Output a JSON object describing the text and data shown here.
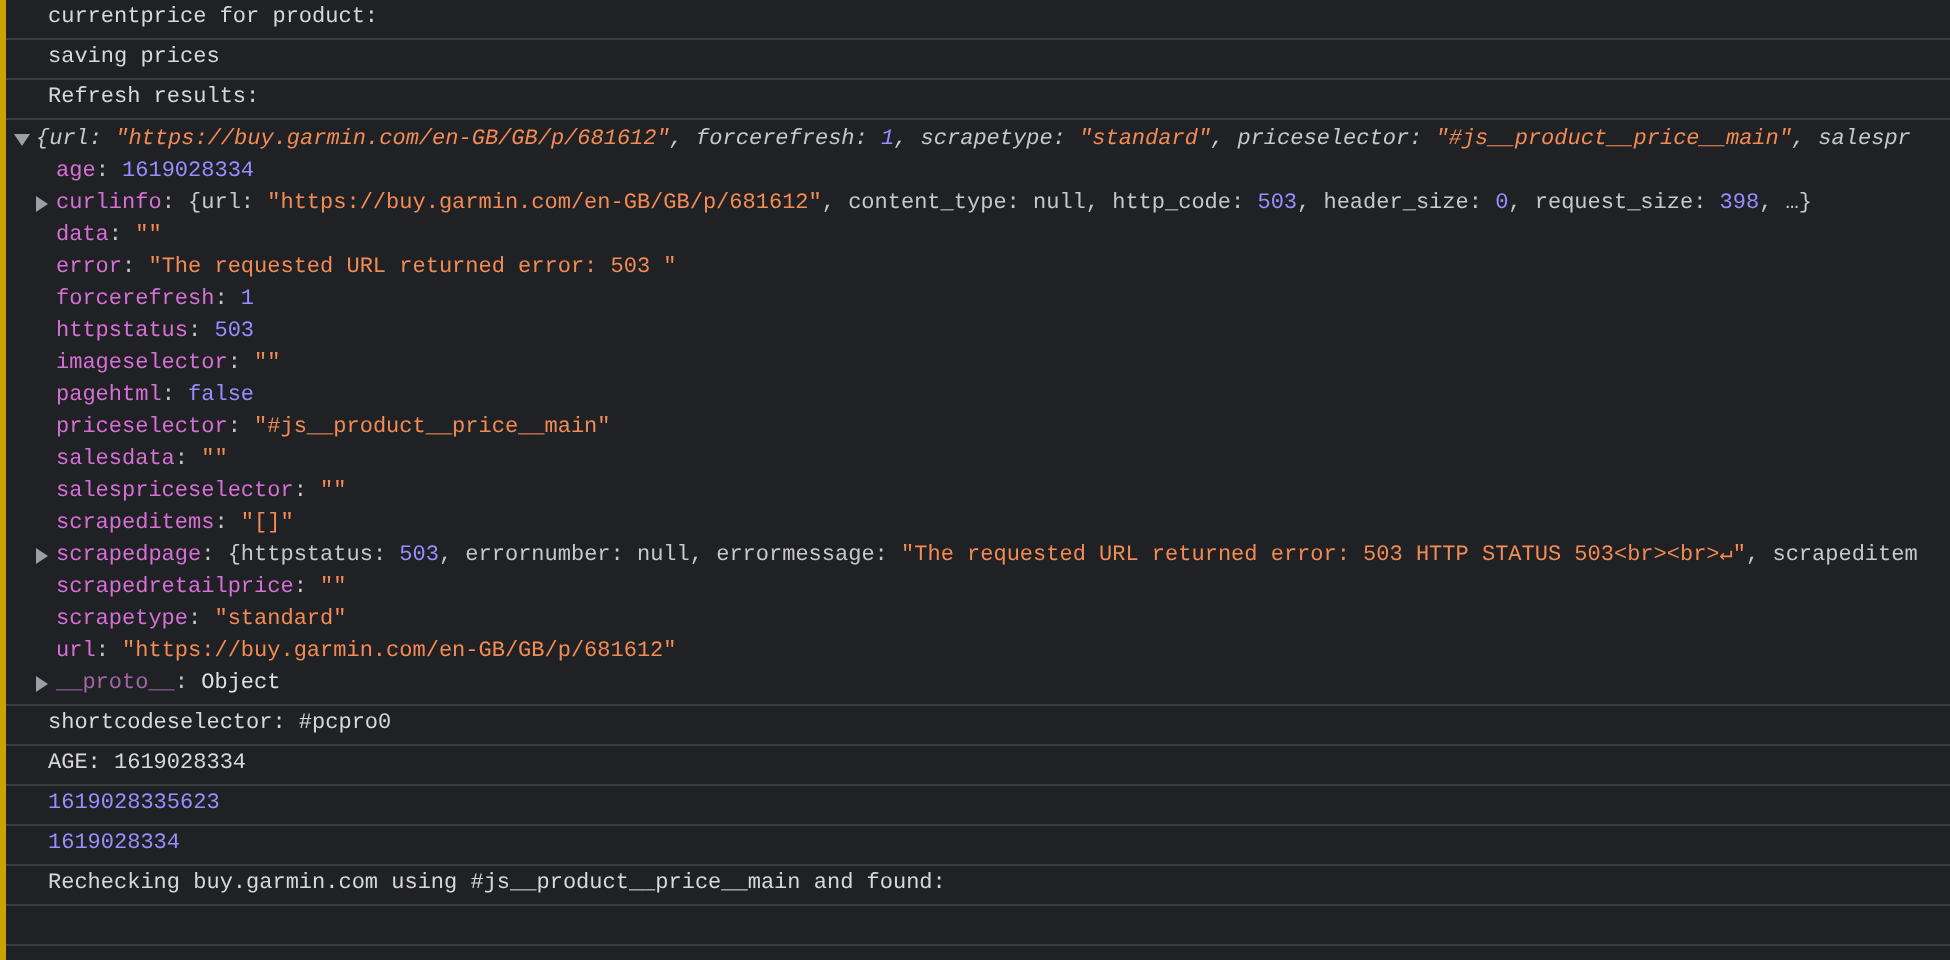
{
  "messages": [
    {
      "kind": "log",
      "text": "currentprice for product:"
    },
    {
      "kind": "log",
      "text": "saving prices"
    },
    {
      "kind": "log",
      "text": "Refresh results:"
    },
    {
      "kind": "object",
      "expanded": true,
      "summary": [
        {
          "kind": "plain",
          "text": "{url: "
        },
        {
          "kind": "string",
          "text": "\"https://buy.garmin.com/en-GB/GB/p/681612\""
        },
        {
          "kind": "plain",
          "text": ", forcerefresh: "
        },
        {
          "kind": "number",
          "text": "1"
        },
        {
          "kind": "plain",
          "text": ", scrapetype: "
        },
        {
          "kind": "string",
          "text": "\"standard\""
        },
        {
          "kind": "plain",
          "text": ", priceselector: "
        },
        {
          "kind": "string",
          "text": "\"#js__product__price__main\""
        },
        {
          "kind": "plain",
          "text": ", salespr"
        }
      ],
      "properties": [
        {
          "key": "age",
          "expandable": false,
          "value": [
            {
              "kind": "plain",
              "text": ": "
            },
            {
              "kind": "number",
              "text": "1619028334"
            }
          ]
        },
        {
          "key": "curlinfo",
          "expandable": true,
          "value": [
            {
              "kind": "plain",
              "text": ": {url: "
            },
            {
              "kind": "string",
              "text": "\"https://buy.garmin.com/en-GB/GB/p/681612\""
            },
            {
              "kind": "plain",
              "text": ", content_type: null, http_code: "
            },
            {
              "kind": "number",
              "text": "503"
            },
            {
              "kind": "plain",
              "text": ", header_size: "
            },
            {
              "kind": "number",
              "text": "0"
            },
            {
              "kind": "plain",
              "text": ", request_size: "
            },
            {
              "kind": "number",
              "text": "398"
            },
            {
              "kind": "plain",
              "text": ", …}"
            }
          ]
        },
        {
          "key": "data",
          "expandable": false,
          "value": [
            {
              "kind": "plain",
              "text": ": "
            },
            {
              "kind": "string",
              "text": "\"\""
            }
          ]
        },
        {
          "key": "error",
          "expandable": false,
          "value": [
            {
              "kind": "plain",
              "text": ": "
            },
            {
              "kind": "string",
              "text": "\"The requested URL returned error: 503 \""
            }
          ]
        },
        {
          "key": "forcerefresh",
          "expandable": false,
          "value": [
            {
              "kind": "plain",
              "text": ": "
            },
            {
              "kind": "number",
              "text": "1"
            }
          ]
        },
        {
          "key": "httpstatus",
          "expandable": false,
          "value": [
            {
              "kind": "plain",
              "text": ": "
            },
            {
              "kind": "number",
              "text": "503"
            }
          ]
        },
        {
          "key": "imageselector",
          "expandable": false,
          "value": [
            {
              "kind": "plain",
              "text": ": "
            },
            {
              "kind": "string",
              "text": "\"\""
            }
          ]
        },
        {
          "key": "pagehtml",
          "expandable": false,
          "value": [
            {
              "kind": "plain",
              "text": ": "
            },
            {
              "kind": "number",
              "text": "false"
            }
          ]
        },
        {
          "key": "priceselector",
          "expandable": false,
          "value": [
            {
              "kind": "plain",
              "text": ": "
            },
            {
              "kind": "string",
              "text": "\"#js__product__price__main\""
            }
          ]
        },
        {
          "key": "salesdata",
          "expandable": false,
          "value": [
            {
              "kind": "plain",
              "text": ": "
            },
            {
              "kind": "string",
              "text": "\"\""
            }
          ]
        },
        {
          "key": "salespriceselector",
          "expandable": false,
          "value": [
            {
              "kind": "plain",
              "text": ": "
            },
            {
              "kind": "string",
              "text": "\"\""
            }
          ]
        },
        {
          "key": "scrapeditems",
          "expandable": false,
          "value": [
            {
              "kind": "plain",
              "text": ": "
            },
            {
              "kind": "string",
              "text": "\"[]\""
            }
          ]
        },
        {
          "key": "scrapedpage",
          "expandable": true,
          "value": [
            {
              "kind": "plain",
              "text": ": {httpstatus: "
            },
            {
              "kind": "number",
              "text": "503"
            },
            {
              "kind": "plain",
              "text": ", errornumber: null, errormessage: "
            },
            {
              "kind": "string",
              "text": "\"The requested URL returned error: 503 HTTP STATUS 503<br><br>↵\""
            },
            {
              "kind": "plain",
              "text": ", scrapeditem"
            }
          ]
        },
        {
          "key": "scrapedretailprice",
          "expandable": false,
          "value": [
            {
              "kind": "plain",
              "text": ": "
            },
            {
              "kind": "string",
              "text": "\"\""
            }
          ]
        },
        {
          "key": "scrapetype",
          "expandable": false,
          "value": [
            {
              "kind": "plain",
              "text": ": "
            },
            {
              "kind": "string",
              "text": "\"standard\""
            }
          ]
        },
        {
          "key": "url",
          "expandable": false,
          "value": [
            {
              "kind": "plain",
              "text": ": "
            },
            {
              "kind": "string",
              "text": "\"https://buy.garmin.com/en-GB/GB/p/681612\""
            }
          ]
        },
        {
          "key": "__proto__",
          "expandable": true,
          "value": [
            {
              "kind": "plain",
              "text": ": "
            },
            {
              "kind": "object",
              "text": "Object"
            }
          ]
        }
      ]
    },
    {
      "kind": "log",
      "text": "shortcodeselector: #pcpro0"
    },
    {
      "kind": "log",
      "text": "AGE: 1619028334"
    },
    {
      "kind": "number",
      "text": "1619028335623"
    },
    {
      "kind": "number",
      "text": "1619028334"
    },
    {
      "kind": "log",
      "text": "Rechecking buy.garmin.com using #js__product__price__main and found:"
    }
  ]
}
